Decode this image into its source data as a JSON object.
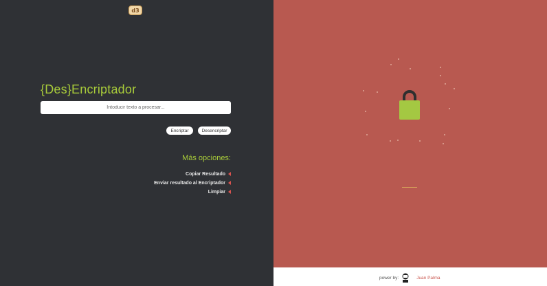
{
  "app": {
    "logo_text": "d3"
  },
  "left_panel": {
    "title": "{Des}Encriptador",
    "input_placeholder": "Intoducir texto a procesar...",
    "buttons": {
      "encrypt": "Encriptar",
      "decrypt": "Desencriptar"
    },
    "more_options_title": "Más opciones:",
    "options": [
      "Copiar Resultado",
      "Enviar resultado al Encriptador",
      "Limpiar"
    ]
  },
  "footer": {
    "powered_by": "power by:",
    "author": "Juan Palma"
  },
  "colors": {
    "left_bg": "#2f3135",
    "right_bg": "#b85950",
    "accent_green": "#a9cc3a",
    "arrow_red": "#d9534f",
    "author_red": "#c9544c"
  },
  "icons": [
    "logo-icon",
    "lock-icon",
    "arrow-left-icon",
    "avatar-icon"
  ]
}
